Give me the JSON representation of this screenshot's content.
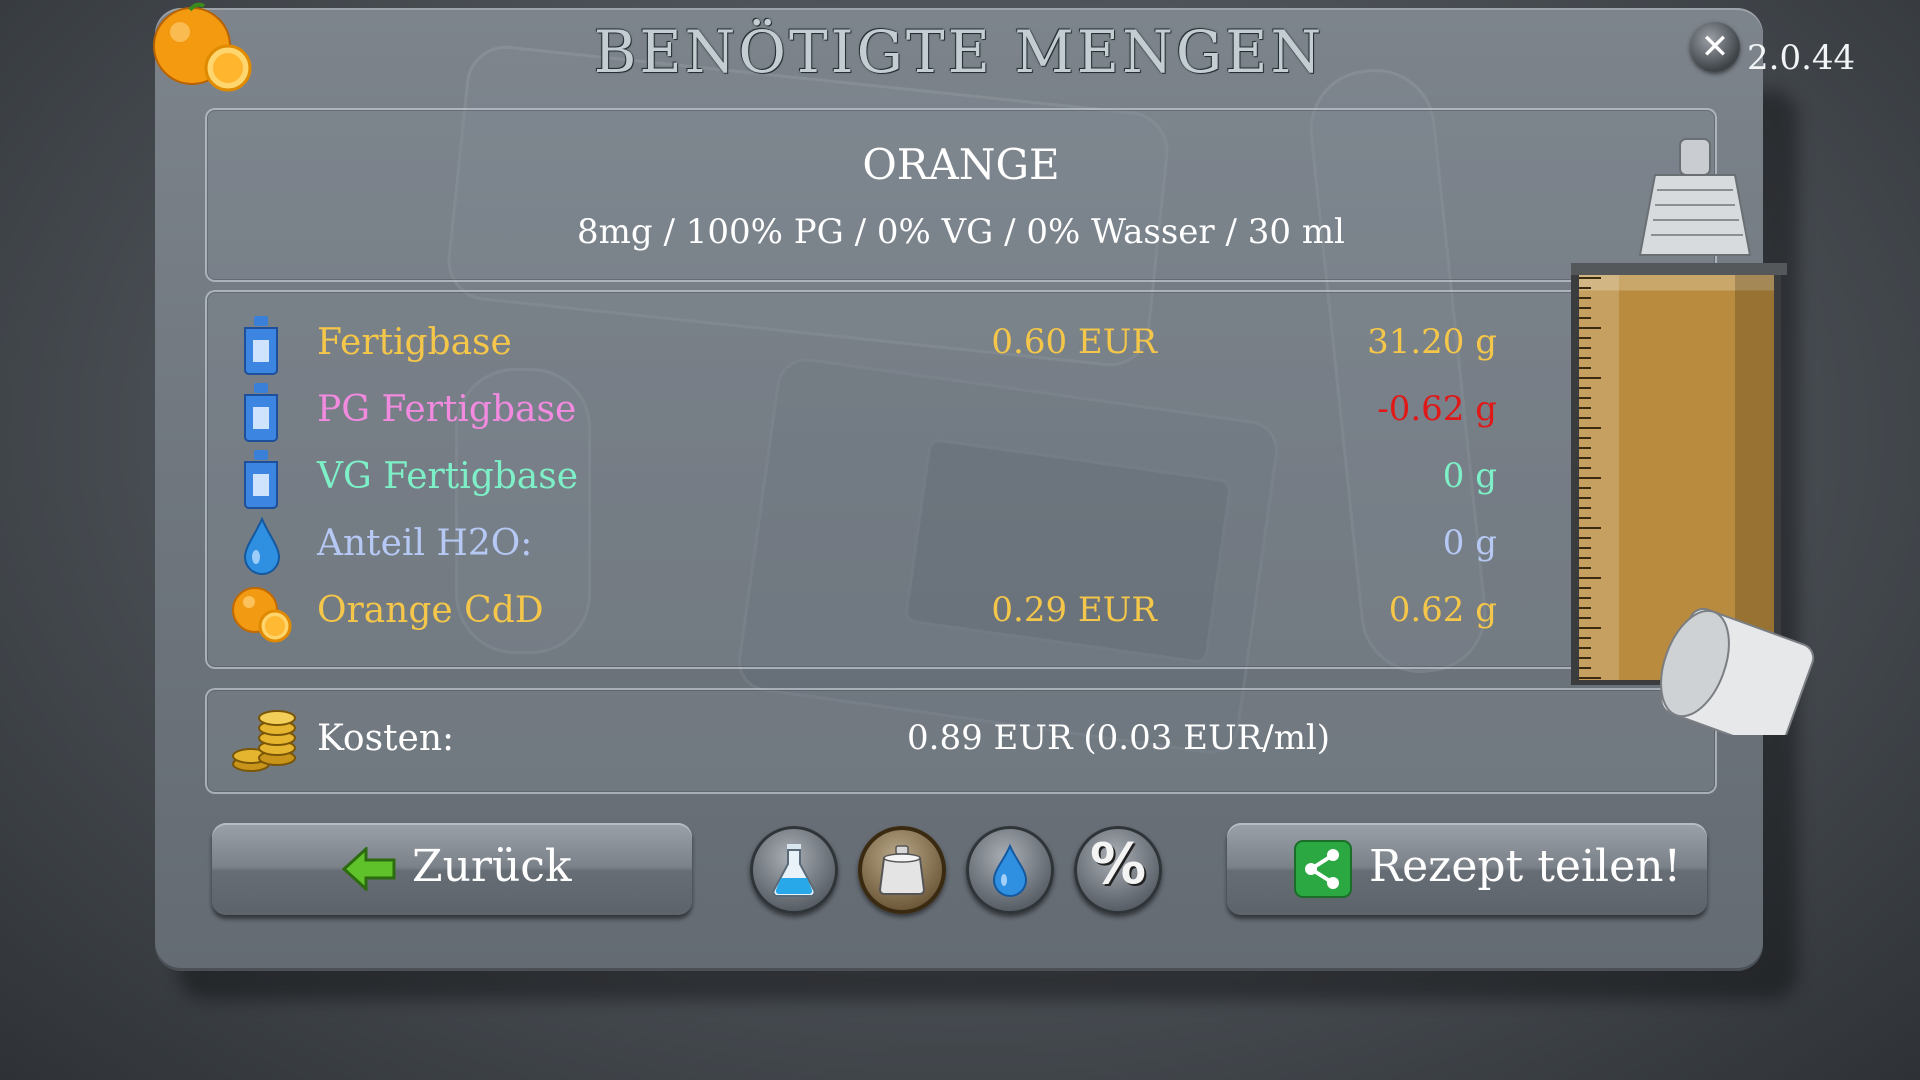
{
  "header": {
    "title": "BENÖTIGTE MENGEN",
    "version": "2.0.44",
    "close_label": "✕"
  },
  "recipe": {
    "name": "ORANGE",
    "spec": "8mg / 100% PG / 0% VG / 0% Wasser / 30 ml"
  },
  "ingredients": [
    {
      "name": "Fertigbase",
      "price": "0.60 EUR",
      "amount": "31.20 g",
      "icon": "bottle-icon",
      "name_color": "#f4c64a",
      "amount_color": "#f4c64a"
    },
    {
      "name": "PG Fertigbase",
      "price": "",
      "amount": "-0.62 g",
      "icon": "bottle-icon",
      "name_color": "#f28ae0",
      "amount_color": "#e01818"
    },
    {
      "name": "VG Fertigbase",
      "price": "",
      "amount": "0 g",
      "icon": "bottle-icon",
      "name_color": "#7ef0c8",
      "amount_color": "#7ef0c8"
    },
    {
      "name": "Anteil H2O:",
      "price": "",
      "amount": "0 g",
      "icon": "water-drop-icon",
      "name_color": "#b6c8f4",
      "amount_color": "#b6c8f4"
    },
    {
      "name": "Orange CdD",
      "price": "0.29 EUR",
      "amount": "0.62 g",
      "icon": "orange-icon",
      "name_color": "#f4c64a",
      "amount_color": "#f4c64a"
    }
  ],
  "cost": {
    "label": "Kosten:",
    "value": "0.89 EUR (0.03 EUR/ml)",
    "icon": "coins-icon"
  },
  "buttons": {
    "back_label": "Zurück",
    "share_label": "Rezept teilen!"
  },
  "tools": [
    "flask-icon",
    "weight-icon",
    "water-drop-icon",
    "percent-icon"
  ],
  "tools_text": {
    "percent": "%"
  },
  "syringe_fill_fraction": 0.95
}
